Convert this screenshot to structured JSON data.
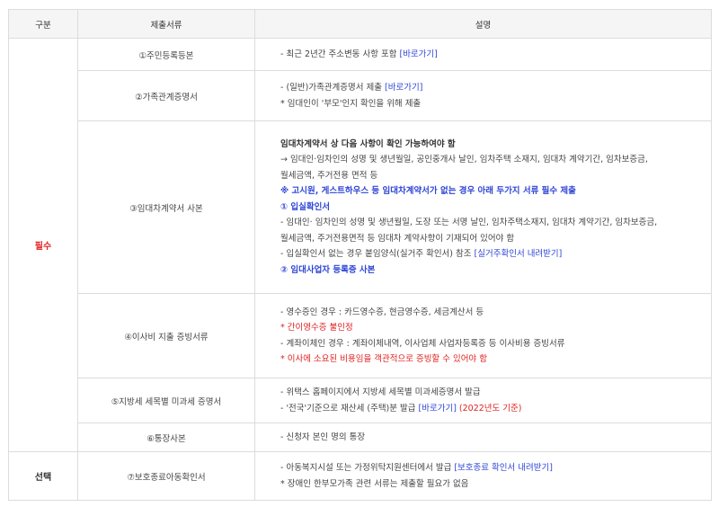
{
  "headers": {
    "category": "구분",
    "documents": "제출서류",
    "description": "설명"
  },
  "groups": {
    "required": "필수",
    "optional": "선택"
  },
  "rows": {
    "r1": {
      "doc": "①주민등록등본",
      "l1_text": "- 최근 2년간 주소변동 사항 포함 ",
      "l1_link": "[바로가기]"
    },
    "r2": {
      "doc": "②가족관계증명서",
      "l1_text": "- (일반)가족관계증명서 제출 ",
      "l1_link": "[바로가기]",
      "l2": "* 임대인이 '부모'인지 확인을 위해 제출"
    },
    "r3": {
      "doc": "③임대차계약서 사본",
      "l1": "임대차계약서 상 다음 사항이 확인 가능하여야 함",
      "l2": "→ 임대인·임차인의 성명 및 생년월일, 공인중개사 날인, 임차주택 소재지, 임대차 계약기간, 임차보증금,",
      "l3": "월세금액, 주거전용 면적 등",
      "l4": "※ 고시원, 게스트하우스 등 임대차계약서가 없는 경우 아래 두가지 서류 필수 제출",
      "l5": "① 입실확인서",
      "l6": "- 임대인· 임차인의 성명 및 생년월일, 도장 또는 서명 날인, 임차주택소재지, 임대차 계약기간, 임차보증금,",
      "l7": "월세금액, 주거전용면적 등 임대차 계약사항이 기재되어 있어야 함",
      "l8_text": "- 입실확인서 없는 경우 붙임양식(실거주 확인서) 참조 ",
      "l8_link": "[실거주확인서 내려받기]",
      "l9": "② 임대사업자 등록증 사본"
    },
    "r4": {
      "doc": "④이사비 지출 증빙서류",
      "l1": "- 영수증인 경우 : 카드영수증, 현금영수증, 세금계산서 등",
      "l2": "* 간이영수증 불인정",
      "l3": "- 계좌이체인 경우 : 계좌이체내역, 이사업체 사업자등록증 등 이사비용 증빙서류",
      "l4": "* 이사에 소요된 비용임을 객관적으로 증빙할 수 있어야 함"
    },
    "r5": {
      "doc": "⑤지방세 세목별 미과세 증명서",
      "l1": "- 위택스 홈페이지에서 지방세 세목별 미과세증명서 발급",
      "l2_text": "- '전국'기준으로 재산세 (주택)분 발급 ",
      "l2_link": "[바로가기]",
      "l2_red": " (2022년도 기준)"
    },
    "r6": {
      "doc": "⑥통장사본",
      "l1": "- 신청자 본인 명의 통장"
    },
    "r7": {
      "doc": "⑦보호종료아동확인서",
      "l1_text": "- 아동복지시설 또는 가정위탁지원센터에서 발급 ",
      "l1_link": "[보호종료 확인서 내려받기]",
      "l2": "* 장애인 한부모가족 관련 서류는 제출할 필요가 없음"
    }
  }
}
